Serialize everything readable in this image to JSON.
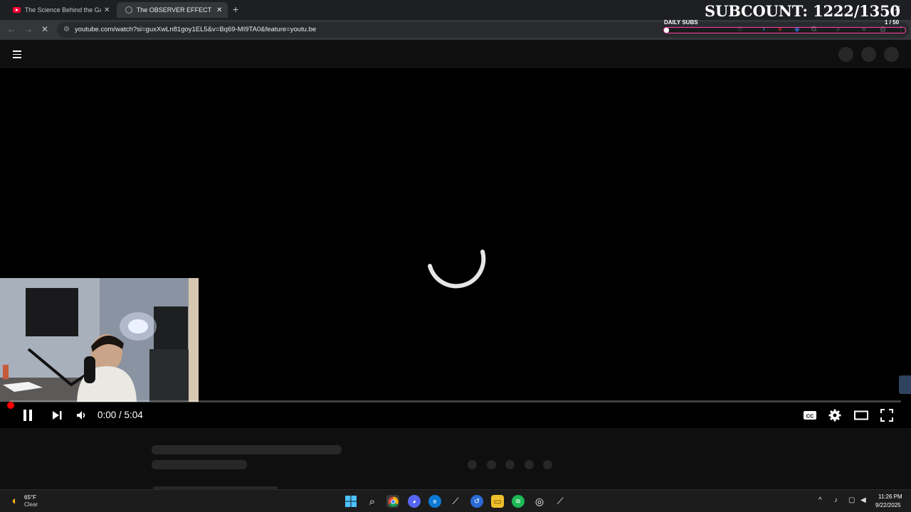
{
  "browser": {
    "tabs": [
      {
        "title": "The Science Behind the Gang W",
        "icon": "youtube-icon",
        "active": false
      },
      {
        "title": "The OBSERVER EFFECT of QUA",
        "icon": "globe-icon",
        "active": true
      }
    ],
    "new_tab_symbol": "+",
    "close_symbol": "✕",
    "url": "youtube.com/watch?si=guxXwLn81goy1EL5&v=Bq69-MI9TA0&feature=youtu.be"
  },
  "overlay": {
    "subcount": "SUBCOUNT: 1222/1350",
    "daily_label": "DAILY SUBS",
    "daily_count": "1 / 50",
    "daily_fraction": 0.02,
    "accent_color": "#ff3ea5"
  },
  "player": {
    "state": "loading",
    "time": "0:00 / 5:04",
    "progress_fraction": 0.0,
    "controls": [
      "pause-icon",
      "next-icon",
      "volume-icon",
      "captions-icon",
      "settings-icon",
      "theater-icon",
      "fullscreen-icon"
    ]
  },
  "taskbar": {
    "weather_temp": "65°F",
    "weather_condition": "Clear",
    "clock_time": "11:26 PM",
    "clock_date": "9/22/2025",
    "apps": [
      "windows-start-icon",
      "search-icon",
      "chrome-icon",
      "discord-icon",
      "edge-icon",
      "steam-icon",
      "app-icon",
      "file-explorer-icon",
      "spotify-icon",
      "obs-icon",
      "steam-icon"
    ]
  },
  "colors": {
    "youtube_red": "#ff0000",
    "page_bg": "#0f0f0f",
    "chrome_dark": "#35363a"
  }
}
